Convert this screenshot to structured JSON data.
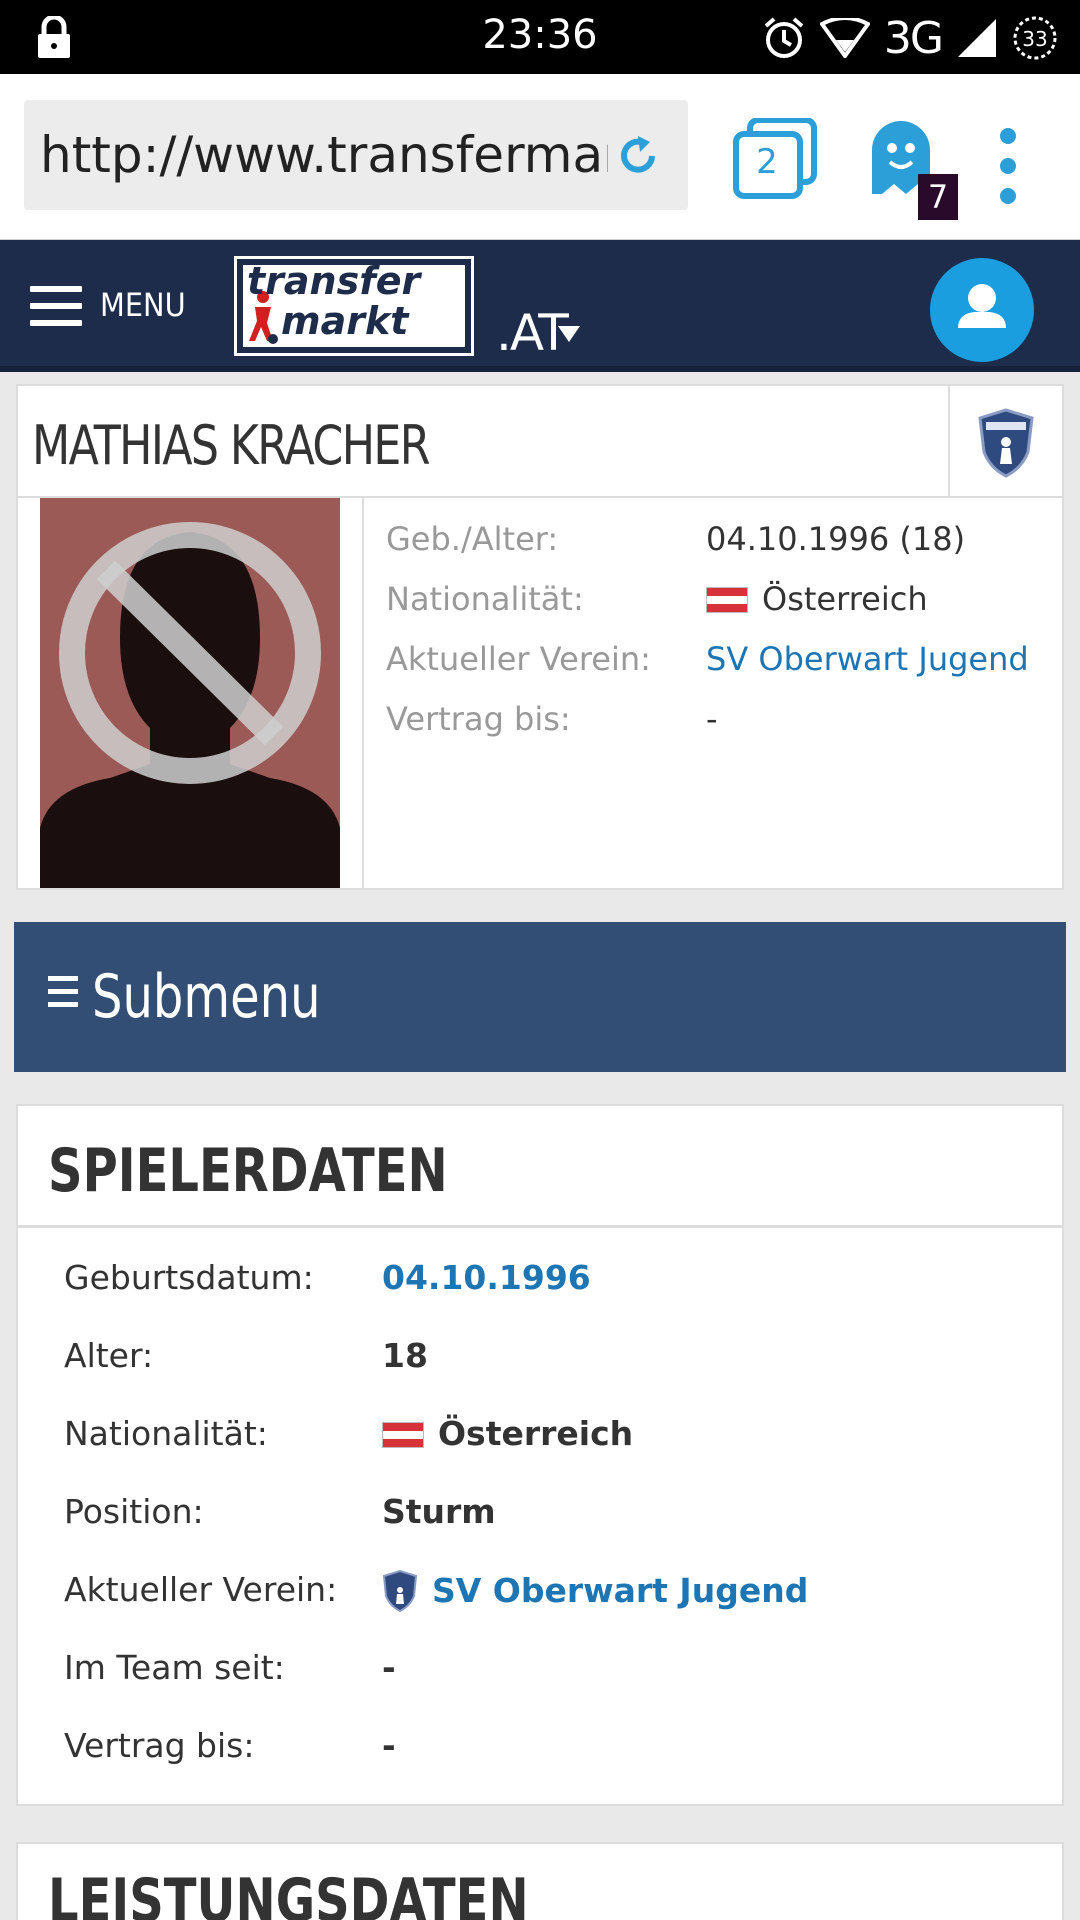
{
  "status_bar": {
    "time": "23:36",
    "network": "3G",
    "battery": "33"
  },
  "browser": {
    "url": "http://www.transfermarkt.at",
    "tab_count": "2",
    "ghost_badge": "7"
  },
  "header": {
    "menu_label": "MENU",
    "logo_line1": "transfer",
    "logo_line2": "markt",
    "tld": ".AT"
  },
  "player": {
    "name": "MATHIAS KRACHER",
    "info": [
      {
        "label": "Geb./Alter:",
        "value": "04.10.1996 (18)"
      },
      {
        "label": "Nationalität:",
        "value": "Österreich"
      },
      {
        "label": "Aktueller Verein:",
        "value": "SV Oberwart Jugend"
      },
      {
        "label": "Vertrag bis:",
        "value": "-"
      }
    ]
  },
  "submenu": {
    "label": "Submenu"
  },
  "spielerdaten": {
    "title": "SPIELERDATEN",
    "rows": [
      {
        "label": "Geburtsdatum:",
        "value": "04.10.1996"
      },
      {
        "label": "Alter:",
        "value": "18"
      },
      {
        "label": "Nationalität:",
        "value": "Österreich"
      },
      {
        "label": "Position:",
        "value": "Sturm"
      },
      {
        "label": "Aktueller Verein:",
        "value": "SV Oberwart Jugend"
      },
      {
        "label": "Im Team seit:",
        "value": "-"
      },
      {
        "label": "Vertrag bis:",
        "value": "-"
      }
    ]
  },
  "leistungsdaten": {
    "title": "LEISTUNGSDATEN"
  },
  "colors": {
    "header_bg": "#1c2c4a",
    "submenu_bg": "#334e74",
    "link": "#1d75b3",
    "accent": "#1a9ee0"
  }
}
